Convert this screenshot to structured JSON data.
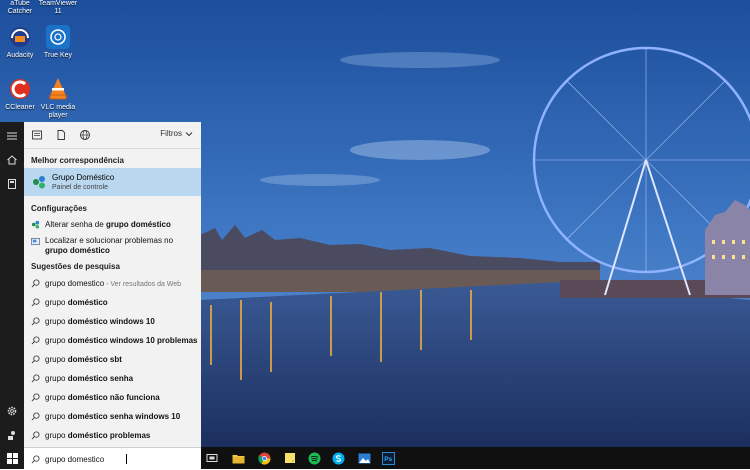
{
  "desktop": {
    "icons": [
      {
        "label": "aTube Catcher",
        "icon": "atube-catcher-icon"
      },
      {
        "label": "TeamViewer 11",
        "icon": "teamviewer-icon"
      },
      {
        "label": "Audacity",
        "icon": "audacity-icon"
      },
      {
        "label": "True Key",
        "icon": "true-key-icon"
      },
      {
        "label": "CCleaner",
        "icon": "ccleaner-icon"
      },
      {
        "label": "VLC media player",
        "icon": "vlc-icon"
      }
    ]
  },
  "search_panel": {
    "filters_label": "Filtros",
    "best_match": {
      "section": "Melhor correspondência",
      "title": "Grupo Doméstico",
      "subtitle": "Painel de controle",
      "icon": "homegroup-icon"
    },
    "settings": {
      "section": "Configurações",
      "items": [
        {
          "prefix": "Alterar senha de ",
          "bold": "grupo doméstico",
          "icon": "homegroup-small-icon"
        },
        {
          "prefix": "Localizar e solucionar problemas no ",
          "bold": "grupo doméstico",
          "icon": "troubleshoot-icon"
        }
      ]
    },
    "suggestions": {
      "section": "Sugestões de pesquisa",
      "items": [
        {
          "prefix": "grupo domestico",
          "bold": "",
          "hint": " - Ver resultados da Web"
        },
        {
          "prefix": "grupo ",
          "bold": "doméstico",
          "hint": ""
        },
        {
          "prefix": "grupo ",
          "bold": "doméstico windows 10",
          "hint": ""
        },
        {
          "prefix": "grupo ",
          "bold": "doméstico windows 10 problemas",
          "hint": ""
        },
        {
          "prefix": "grupo ",
          "bold": "doméstico sbt",
          "hint": ""
        },
        {
          "prefix": "grupo ",
          "bold": "doméstico senha",
          "hint": ""
        },
        {
          "prefix": "grupo ",
          "bold": "doméstico não funciona",
          "hint": ""
        },
        {
          "prefix": "grupo ",
          "bold": "doméstico senha windows 10",
          "hint": ""
        },
        {
          "prefix": "grupo ",
          "bold": "doméstico problemas",
          "hint": ""
        }
      ]
    },
    "search_box": {
      "value": "grupo domestico"
    }
  },
  "taskbar": {
    "apps": [
      "task-view-icon",
      "file-explorer-icon",
      "chrome-icon",
      "sticky-notes-icon",
      "spotify-icon",
      "skype-icon",
      "photos-icon",
      "photoshop-icon"
    ]
  }
}
